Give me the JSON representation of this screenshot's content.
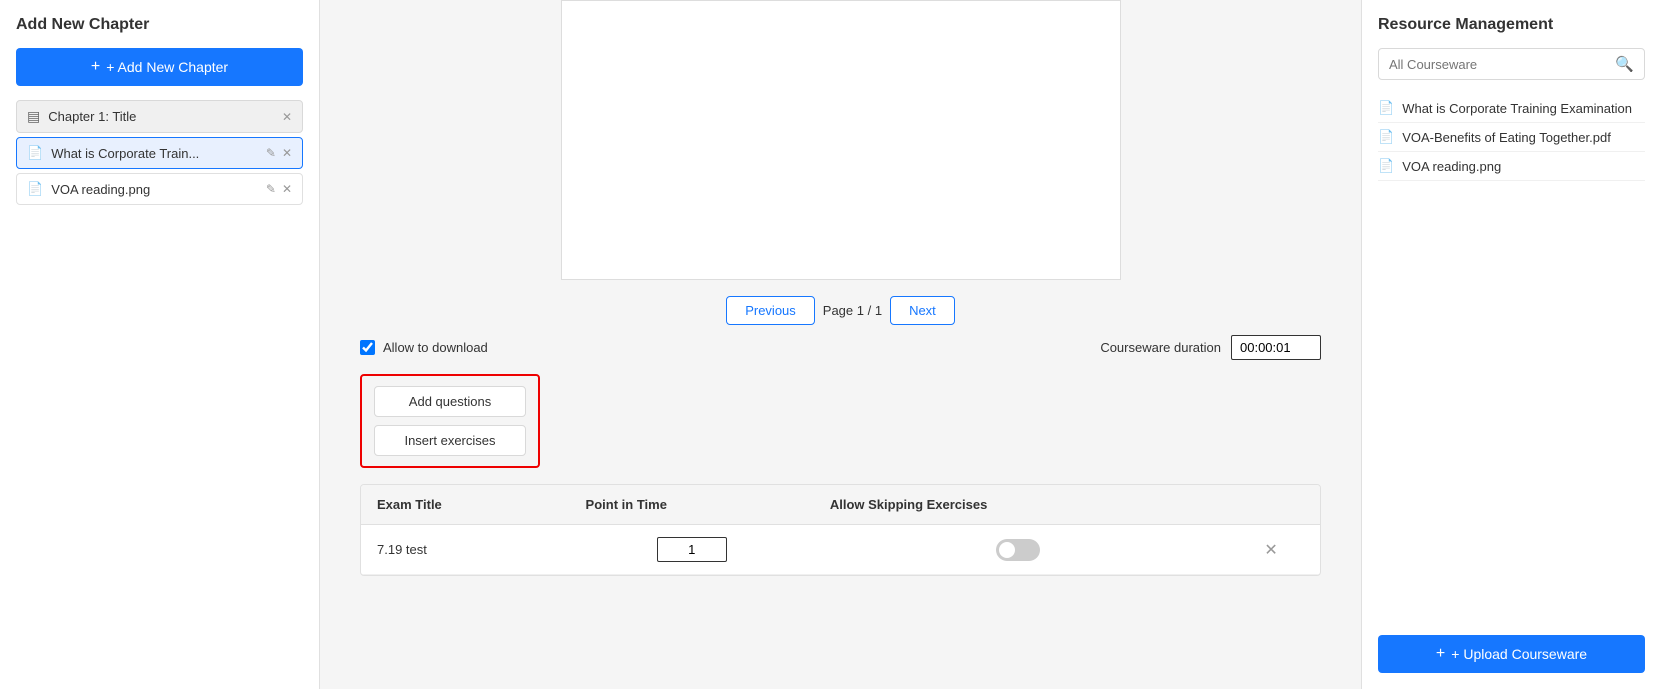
{
  "sidebar": {
    "title": "Add New Chapter",
    "add_button_label": "+ Add New Chapter",
    "chapter": {
      "label": "Chapter 1: Title",
      "icon": "▤"
    },
    "items": [
      {
        "label": "What is Corporate Train...",
        "active": true
      },
      {
        "label": "VOA reading.png",
        "active": false
      }
    ]
  },
  "pagination": {
    "previous_label": "Previous",
    "next_label": "Next",
    "page_text": "Page 1 / 1"
  },
  "controls": {
    "allow_download_label": "Allow to download",
    "allow_download_checked": true,
    "duration_label": "Courseware duration",
    "duration_value": "00:00:01"
  },
  "action_buttons": [
    {
      "label": "Add questions"
    },
    {
      "label": "Insert exercises"
    }
  ],
  "exam_table": {
    "columns": [
      "Exam Title",
      "Point in Time",
      "Allow Skipping Exercises"
    ],
    "rows": [
      {
        "title": "7.19 test",
        "point": "1",
        "skipping": false
      }
    ]
  },
  "resource_panel": {
    "title": "Resource Management",
    "search_placeholder": "All Courseware",
    "resources": [
      {
        "label": "What is Corporate Training Examination"
      },
      {
        "label": "VOA-Benefits of Eating Together.pdf"
      },
      {
        "label": "VOA reading.png"
      }
    ],
    "upload_label": "+ Upload Courseware"
  }
}
